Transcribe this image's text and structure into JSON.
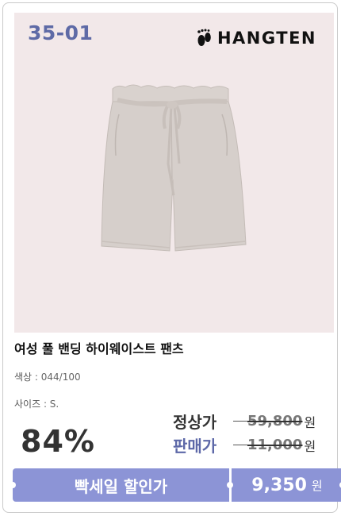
{
  "product_code": "35-01",
  "brand": {
    "name": "HANGTEN"
  },
  "product": {
    "name": "여성 풀 밴딩 하이웨이스트 팬츠",
    "color_label": "색상",
    "color_value": ": 044/100",
    "size_label": "사이즈",
    "size_value": ": S."
  },
  "pricing": {
    "discount_rate": "84%",
    "regular_label": "정상가",
    "regular_price": "59,800",
    "sale_label": "판매가",
    "sale_price": "11,000",
    "won": "원",
    "flash_sale_label": "빡세일 할인가",
    "flash_price": "9,350",
    "flash_won": "원"
  },
  "colors": {
    "accent": "#8c94d6",
    "code_color": "#5e6aa6",
    "photo_bg": "#f2e8e9"
  },
  "icons": {
    "brand_logo": "footprint-icon"
  }
}
